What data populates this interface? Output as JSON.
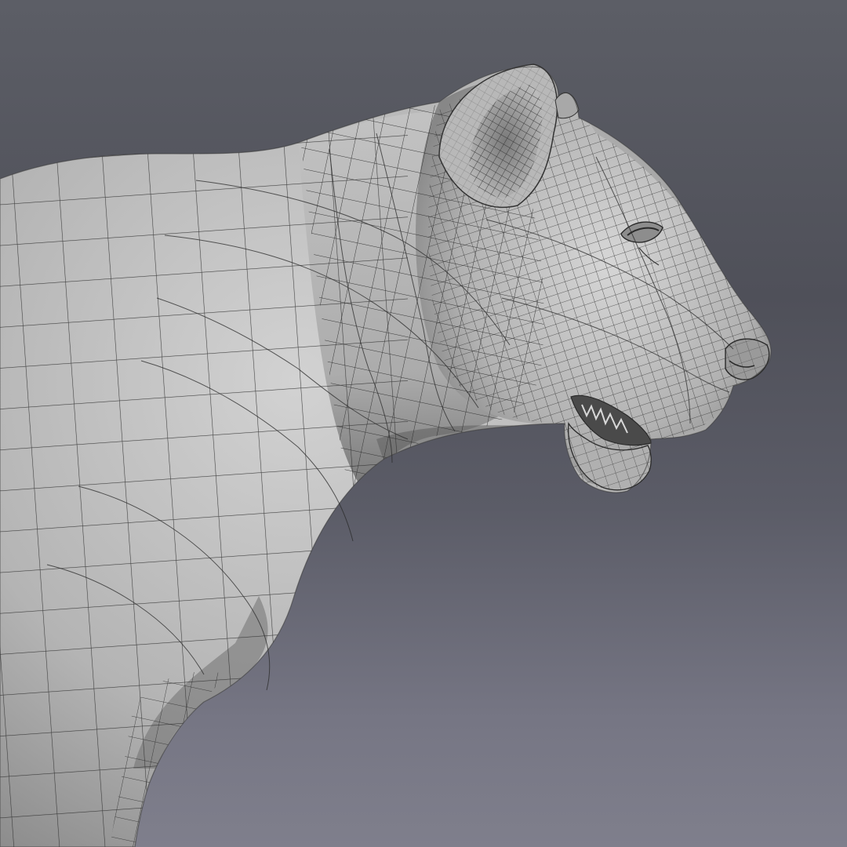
{
  "scene": {
    "subject_icon": "lioness-wireframe-icon",
    "view": "side profile",
    "colors": {
      "background_top": "#5c5e66",
      "background_bottom": "#7f7f8c",
      "model_light": "#c9c9c9",
      "model_mid": "#a9a9a9",
      "model_shadow": "#6f6f6f",
      "wire": "#2b2b2b"
    }
  }
}
